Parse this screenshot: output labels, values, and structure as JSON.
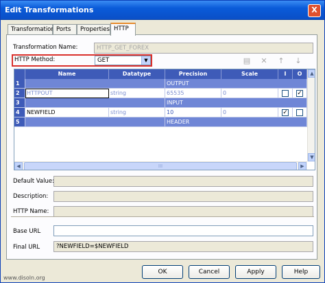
{
  "window": {
    "title": "Edit Transformations",
    "close_label": "X"
  },
  "tabs": [
    {
      "label": "Transformation"
    },
    {
      "label": "Ports"
    },
    {
      "label": "Properties"
    },
    {
      "label": "HTTP"
    }
  ],
  "form": {
    "transformation_name_label": "Transformation Name:",
    "transformation_name_value": "HTTP_GET_FOREX",
    "http_method_label": "HTTP Method:",
    "http_method_value": "GET",
    "default_value_label": "Default Value:",
    "description_label": "Description:",
    "http_name_label": "HTTP Name:",
    "base_url_label": "Base URL",
    "base_url_value": "",
    "final_url_label": "Final URL",
    "final_url_value": "?NEWFIELD=$NEWFIELD"
  },
  "toolbar_icons": [
    "new-icon",
    "delete-icon",
    "move-up-icon",
    "move-down-icon"
  ],
  "grid": {
    "columns": [
      "Name",
      "Datatype",
      "Precision",
      "Scale",
      "I",
      "O"
    ],
    "rows": [
      {
        "num": "1",
        "kind": "group",
        "label": "OUTPUT"
      },
      {
        "num": "2",
        "kind": "port",
        "name": "HTTPOUT",
        "datatype": "string",
        "precision": "65535",
        "scale": "0",
        "input": false,
        "output": true
      },
      {
        "num": "3",
        "kind": "group",
        "label": "INPUT"
      },
      {
        "num": "4",
        "kind": "port",
        "name": "NEWFIELD",
        "datatype": "string",
        "precision": "10",
        "scale": "0",
        "input": true,
        "output": false
      },
      {
        "num": "5",
        "kind": "group",
        "label": "HEADER"
      }
    ],
    "scroll_grip": "III"
  },
  "buttons": {
    "ok": "OK",
    "cancel": "Cancel",
    "apply": "Apply",
    "help": "Help"
  },
  "watermark": "www.disoln.org",
  "colors": {
    "title_bar": "#0A5BD9",
    "grid_header": "#3E5BB8",
    "group_row": "#6F86D6",
    "highlight_border": "#D9302B"
  }
}
